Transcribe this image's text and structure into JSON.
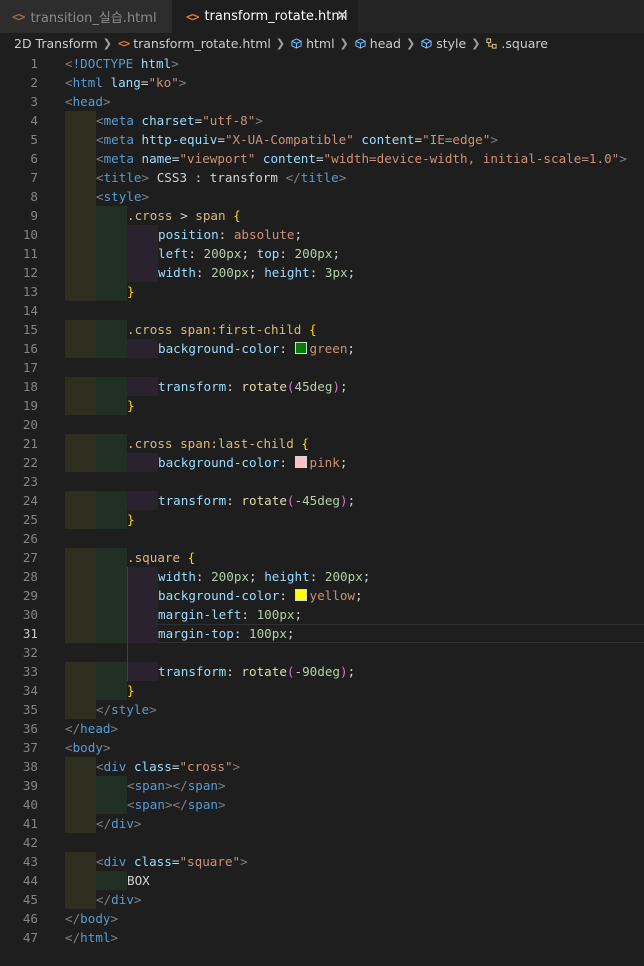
{
  "tabs": [
    {
      "icon": "<>",
      "label": "transition_실습.html",
      "active": false
    },
    {
      "icon": "<>",
      "label": "transform_rotate.html",
      "active": true,
      "close": "✕"
    }
  ],
  "breadcrumb": [
    "2D Transform",
    "transform_rotate.html",
    "html",
    "head",
    "style",
    ".square"
  ],
  "active_line": 31,
  "colors": {
    "background": "#1e1e1e",
    "tag": "#569cd6",
    "attribute": "#9cdcfe",
    "string": "#ce9178",
    "selector": "#d7ba7d",
    "number": "#b5cea8",
    "function": "#dcdcaa",
    "brace": "#ffd700",
    "paren": "#da70d6"
  },
  "lines": [
    {
      "n": 1,
      "indent": 0,
      "tokens": [
        [
          "br",
          "<"
        ],
        [
          "tag",
          "!DOCTYPE "
        ],
        [
          "attr",
          "html"
        ],
        [
          "br",
          ">"
        ]
      ]
    },
    {
      "n": 2,
      "indent": 0,
      "tokens": [
        [
          "br",
          "<"
        ],
        [
          "tag",
          "html "
        ],
        [
          "attr",
          "lang"
        ],
        [
          "text",
          "="
        ],
        [
          "str",
          "\"ko\""
        ],
        [
          "br",
          ">"
        ]
      ]
    },
    {
      "n": 3,
      "indent": 0,
      "tokens": [
        [
          "br",
          "<"
        ],
        [
          "tag",
          "head"
        ],
        [
          "br",
          ">"
        ]
      ]
    },
    {
      "n": 4,
      "indent": 1,
      "tokens": [
        [
          "br",
          "<"
        ],
        [
          "tag",
          "meta "
        ],
        [
          "attr",
          "charset"
        ],
        [
          "text",
          "="
        ],
        [
          "str",
          "\"utf-8\""
        ],
        [
          "br",
          ">"
        ]
      ]
    },
    {
      "n": 5,
      "indent": 1,
      "tokens": [
        [
          "br",
          "<"
        ],
        [
          "tag",
          "meta "
        ],
        [
          "attr",
          "http-equiv"
        ],
        [
          "text",
          "="
        ],
        [
          "str",
          "\"X-UA-Compatible\" "
        ],
        [
          "attr",
          "content"
        ],
        [
          "text",
          "="
        ],
        [
          "str",
          "\"IE=edge\""
        ],
        [
          "br",
          ">"
        ]
      ]
    },
    {
      "n": 6,
      "indent": 1,
      "tokens": [
        [
          "br",
          "<"
        ],
        [
          "tag",
          "meta "
        ],
        [
          "attr",
          "name"
        ],
        [
          "text",
          "="
        ],
        [
          "str",
          "\"viewport\" "
        ],
        [
          "attr",
          "content"
        ],
        [
          "text",
          "="
        ],
        [
          "str",
          "\"width=device-width, initial-scale=1.0\""
        ],
        [
          "br",
          ">"
        ]
      ]
    },
    {
      "n": 7,
      "indent": 1,
      "tokens": [
        [
          "br",
          "<"
        ],
        [
          "tag",
          "title"
        ],
        [
          "br",
          ">"
        ],
        [
          "text",
          " CSS3 : transform "
        ],
        [
          "br",
          "</"
        ],
        [
          "tag",
          "title"
        ],
        [
          "br",
          ">"
        ]
      ]
    },
    {
      "n": 8,
      "indent": 1,
      "tokens": [
        [
          "br",
          "<"
        ],
        [
          "tag",
          "style"
        ],
        [
          "br",
          ">"
        ]
      ]
    },
    {
      "n": 9,
      "indent": 2,
      "tokens": [
        [
          "sel",
          ".cross "
        ],
        [
          "punc",
          "> "
        ],
        [
          "sel",
          "span "
        ],
        [
          "brace",
          "{"
        ]
      ]
    },
    {
      "n": 10,
      "indent": 3,
      "tokens": [
        [
          "prop",
          "position"
        ],
        [
          "punc",
          ": "
        ],
        [
          "val",
          "absolute"
        ],
        [
          "punc",
          ";"
        ]
      ]
    },
    {
      "n": 11,
      "indent": 3,
      "tokens": [
        [
          "prop",
          "left"
        ],
        [
          "punc",
          ": "
        ],
        [
          "num",
          "200px"
        ],
        [
          "punc",
          "; "
        ],
        [
          "prop",
          "top"
        ],
        [
          "punc",
          ": "
        ],
        [
          "num",
          "200px"
        ],
        [
          "punc",
          ";"
        ]
      ]
    },
    {
      "n": 12,
      "indent": 3,
      "tokens": [
        [
          "prop",
          "width"
        ],
        [
          "punc",
          ": "
        ],
        [
          "num",
          "200px"
        ],
        [
          "punc",
          "; "
        ],
        [
          "prop",
          "height"
        ],
        [
          "punc",
          ": "
        ],
        [
          "num",
          "3px"
        ],
        [
          "punc",
          ";"
        ]
      ]
    },
    {
      "n": 13,
      "indent": 2,
      "tokens": [
        [
          "brace",
          "}"
        ]
      ]
    },
    {
      "n": 14,
      "indent": 0,
      "tokens": []
    },
    {
      "n": 15,
      "indent": 2,
      "tokens": [
        [
          "sel",
          ".cross span:first-child "
        ],
        [
          "brace",
          "{"
        ]
      ]
    },
    {
      "n": 16,
      "indent": 3,
      "tokens": [
        [
          "prop",
          "background-color"
        ],
        [
          "punc",
          ": "
        ],
        [
          "swatch",
          "#008000"
        ],
        [
          "val",
          "green"
        ],
        [
          "punc",
          ";"
        ]
      ]
    },
    {
      "n": 17,
      "indent": 0,
      "tokens": []
    },
    {
      "n": 18,
      "indent": 3,
      "tokens": [
        [
          "prop",
          "transform"
        ],
        [
          "punc",
          ": "
        ],
        [
          "fn",
          "rotate"
        ],
        [
          "paren",
          "("
        ],
        [
          "num",
          "45deg"
        ],
        [
          "paren",
          ")"
        ],
        [
          "punc",
          ";"
        ]
      ]
    },
    {
      "n": 19,
      "indent": 2,
      "tokens": [
        [
          "brace",
          "}"
        ]
      ]
    },
    {
      "n": 20,
      "indent": 0,
      "tokens": []
    },
    {
      "n": 21,
      "indent": 2,
      "tokens": [
        [
          "sel",
          ".cross span:last-child "
        ],
        [
          "brace",
          "{"
        ]
      ]
    },
    {
      "n": 22,
      "indent": 3,
      "tokens": [
        [
          "prop",
          "background-color"
        ],
        [
          "punc",
          ": "
        ],
        [
          "swatch",
          "#ffc0cb"
        ],
        [
          "val",
          "pink"
        ],
        [
          "punc",
          ";"
        ]
      ]
    },
    {
      "n": 23,
      "indent": 0,
      "tokens": []
    },
    {
      "n": 24,
      "indent": 3,
      "tokens": [
        [
          "prop",
          "transform"
        ],
        [
          "punc",
          ": "
        ],
        [
          "fn",
          "rotate"
        ],
        [
          "paren",
          "("
        ],
        [
          "num",
          "-45deg"
        ],
        [
          "paren",
          ")"
        ],
        [
          "punc",
          ";"
        ]
      ]
    },
    {
      "n": 25,
      "indent": 2,
      "tokens": [
        [
          "brace",
          "}"
        ]
      ]
    },
    {
      "n": 26,
      "indent": 0,
      "tokens": []
    },
    {
      "n": 27,
      "indent": 2,
      "tokens": [
        [
          "sel",
          ".square "
        ],
        [
          "brace",
          "{"
        ]
      ]
    },
    {
      "n": 28,
      "indent": 3,
      "tokens": [
        [
          "prop",
          "width"
        ],
        [
          "punc",
          ": "
        ],
        [
          "num",
          "200px"
        ],
        [
          "punc",
          "; "
        ],
        [
          "prop",
          "height"
        ],
        [
          "punc",
          ": "
        ],
        [
          "num",
          "200px"
        ],
        [
          "punc",
          ";"
        ]
      ]
    },
    {
      "n": 29,
      "indent": 3,
      "tokens": [
        [
          "prop",
          "background-color"
        ],
        [
          "punc",
          ": "
        ],
        [
          "swatch",
          "#ffff00"
        ],
        [
          "val",
          "yellow"
        ],
        [
          "punc",
          ";"
        ]
      ]
    },
    {
      "n": 30,
      "indent": 3,
      "tokens": [
        [
          "prop",
          "margin-left"
        ],
        [
          "punc",
          ": "
        ],
        [
          "num",
          "100px"
        ],
        [
          "punc",
          ";"
        ]
      ]
    },
    {
      "n": 31,
      "indent": 3,
      "tokens": [
        [
          "prop",
          "margin-top"
        ],
        [
          "punc",
          ": "
        ],
        [
          "num",
          "100px"
        ],
        [
          "punc",
          ";"
        ]
      ]
    },
    {
      "n": 32,
      "indent": 0,
      "tokens": []
    },
    {
      "n": 33,
      "indent": 3,
      "tokens": [
        [
          "prop",
          "transform"
        ],
        [
          "punc",
          ": "
        ],
        [
          "fn",
          "rotate"
        ],
        [
          "paren",
          "("
        ],
        [
          "num",
          "-90deg"
        ],
        [
          "paren",
          ")"
        ],
        [
          "punc",
          ";"
        ]
      ]
    },
    {
      "n": 34,
      "indent": 2,
      "tokens": [
        [
          "brace",
          "}"
        ]
      ]
    },
    {
      "n": 35,
      "indent": 1,
      "tokens": [
        [
          "br",
          "</"
        ],
        [
          "tag",
          "style"
        ],
        [
          "br",
          ">"
        ]
      ]
    },
    {
      "n": 36,
      "indent": 0,
      "tokens": [
        [
          "br",
          "</"
        ],
        [
          "tag",
          "head"
        ],
        [
          "br",
          ">"
        ]
      ]
    },
    {
      "n": 37,
      "indent": 0,
      "tokens": [
        [
          "br",
          "<"
        ],
        [
          "tag",
          "body"
        ],
        [
          "br",
          ">"
        ]
      ]
    },
    {
      "n": 38,
      "indent": 1,
      "tokens": [
        [
          "br",
          "<"
        ],
        [
          "tag",
          "div "
        ],
        [
          "attr",
          "class"
        ],
        [
          "text",
          "="
        ],
        [
          "str",
          "\"cross\""
        ],
        [
          "br",
          ">"
        ]
      ]
    },
    {
      "n": 39,
      "indent": 2,
      "tokens": [
        [
          "br",
          "<"
        ],
        [
          "tag",
          "span"
        ],
        [
          "br",
          "></"
        ],
        [
          "tag",
          "span"
        ],
        [
          "br",
          ">"
        ]
      ]
    },
    {
      "n": 40,
      "indent": 2,
      "tokens": [
        [
          "br",
          "<"
        ],
        [
          "tag",
          "span"
        ],
        [
          "br",
          "></"
        ],
        [
          "tag",
          "span"
        ],
        [
          "br",
          ">"
        ]
      ]
    },
    {
      "n": 41,
      "indent": 1,
      "tokens": [
        [
          "br",
          "</"
        ],
        [
          "tag",
          "div"
        ],
        [
          "br",
          ">"
        ]
      ]
    },
    {
      "n": 42,
      "indent": 0,
      "tokens": []
    },
    {
      "n": 43,
      "indent": 1,
      "tokens": [
        [
          "br",
          "<"
        ],
        [
          "tag",
          "div "
        ],
        [
          "attr",
          "class"
        ],
        [
          "text",
          "="
        ],
        [
          "str",
          "\"square\""
        ],
        [
          "br",
          ">"
        ]
      ]
    },
    {
      "n": 44,
      "indent": 2,
      "tokens": [
        [
          "text",
          "BOX"
        ]
      ]
    },
    {
      "n": 45,
      "indent": 1,
      "tokens": [
        [
          "br",
          "</"
        ],
        [
          "tag",
          "div"
        ],
        [
          "br",
          ">"
        ]
      ]
    },
    {
      "n": 46,
      "indent": 0,
      "tokens": [
        [
          "br",
          "</"
        ],
        [
          "tag",
          "body"
        ],
        [
          "br",
          ">"
        ]
      ]
    },
    {
      "n": 47,
      "indent": 0,
      "tokens": [
        [
          "br",
          "</"
        ],
        [
          "tag",
          "html"
        ],
        [
          "br",
          ">"
        ]
      ]
    }
  ]
}
